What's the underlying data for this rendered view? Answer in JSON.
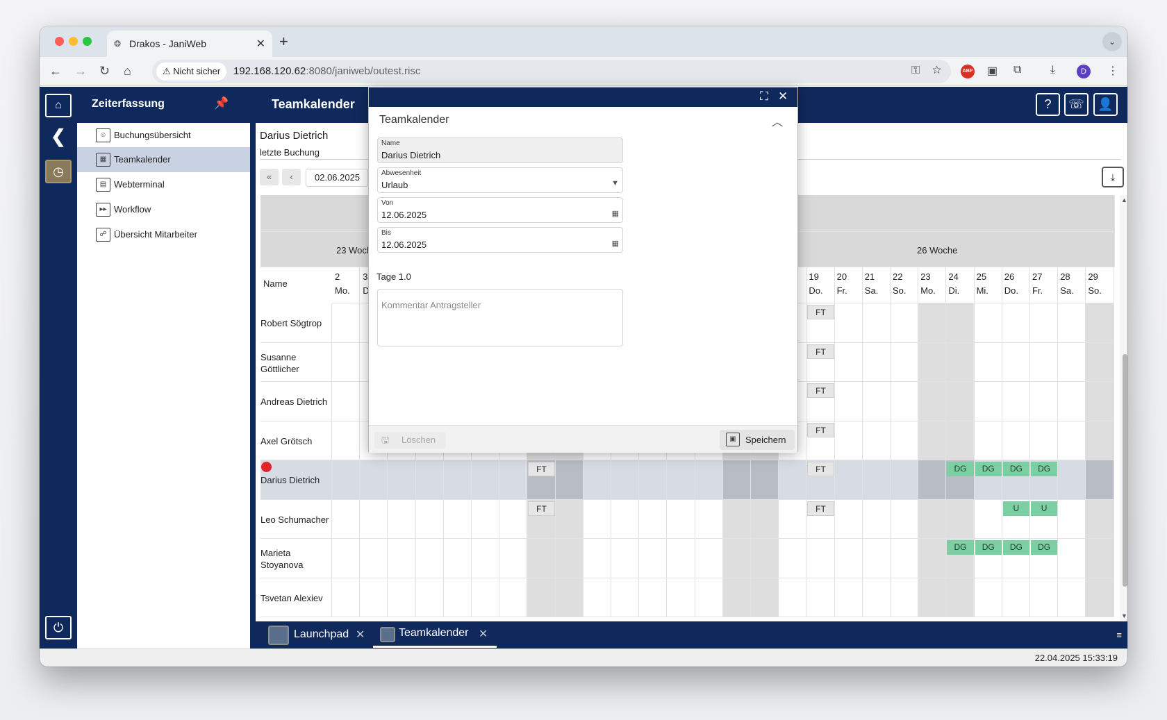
{
  "browser": {
    "tab_title": "Drakos - JaniWeb",
    "security_label": "Nicht sicher",
    "url_host": "192.168.120.62",
    "url_rest": ":8080/janiweb/outest.risc",
    "profile_initial": "D",
    "abp_label": "ABP"
  },
  "app": {
    "sidebar_title": "Zeiterfassung",
    "sidebar_items": [
      {
        "label": "Buchungsübersicht"
      },
      {
        "label": "Teamkalender"
      },
      {
        "label": "Webterminal"
      },
      {
        "label": "Workflow"
      },
      {
        "label": "Übersicht Mitarbeiter"
      }
    ],
    "main_title": "Teamkalender",
    "employee_name": "Darius Dietrich",
    "last_booking_label": "letzte Buchung",
    "date_value": "02.06.2025",
    "status_datetime": "22.04.2025 15:33:19"
  },
  "calendar": {
    "name_header": "Name",
    "week_labels": [
      "23 Woche",
      "26 Woche"
    ],
    "days_left": [
      {
        "num": "2",
        "wd": "Mo."
      },
      {
        "num": "3",
        "wd": "Di."
      }
    ],
    "days_right": [
      {
        "num": "19",
        "wd": "Do."
      },
      {
        "num": "20",
        "wd": "Fr."
      },
      {
        "num": "21",
        "wd": "Sa."
      },
      {
        "num": "22",
        "wd": "So."
      },
      {
        "num": "23",
        "wd": "Mo."
      },
      {
        "num": "24",
        "wd": "Di."
      },
      {
        "num": "25",
        "wd": "Mi."
      },
      {
        "num": "26",
        "wd": "Do."
      },
      {
        "num": "27",
        "wd": "Fr."
      },
      {
        "num": "28",
        "wd": "Sa."
      },
      {
        "num": "29",
        "wd": "So."
      }
    ],
    "rows": [
      {
        "name": "Robert Sögtrop"
      },
      {
        "name": "Susanne Göttlicher"
      },
      {
        "name": "Andreas Dietrich"
      },
      {
        "name": "Axel Grötsch"
      },
      {
        "name": "Darius Dietrich"
      },
      {
        "name": "Leo Schumacher"
      },
      {
        "name": "Marieta Stoyanova"
      },
      {
        "name": "Tsvetan Alexiev"
      }
    ],
    "badge_ft": "FT",
    "badge_dg": "DG",
    "badge_u": "U"
  },
  "taskbar": {
    "tabs": [
      {
        "label": "Launchpad"
      },
      {
        "label": "Teamkalender"
      }
    ]
  },
  "dialog": {
    "title": "Teamkalender",
    "name_label": "Name",
    "name_value": "Darius Dietrich",
    "absence_label": "Abwesenheit",
    "absence_value": "Urlaub",
    "from_label": "Von",
    "from_value": "12.06.2025",
    "to_label": "Bis",
    "to_value": "12.06.2025",
    "days_text": "Tage 1.0",
    "comment_placeholder": "Kommentar Antragsteller",
    "delete_label": "Löschen",
    "save_label": "Speichern"
  }
}
